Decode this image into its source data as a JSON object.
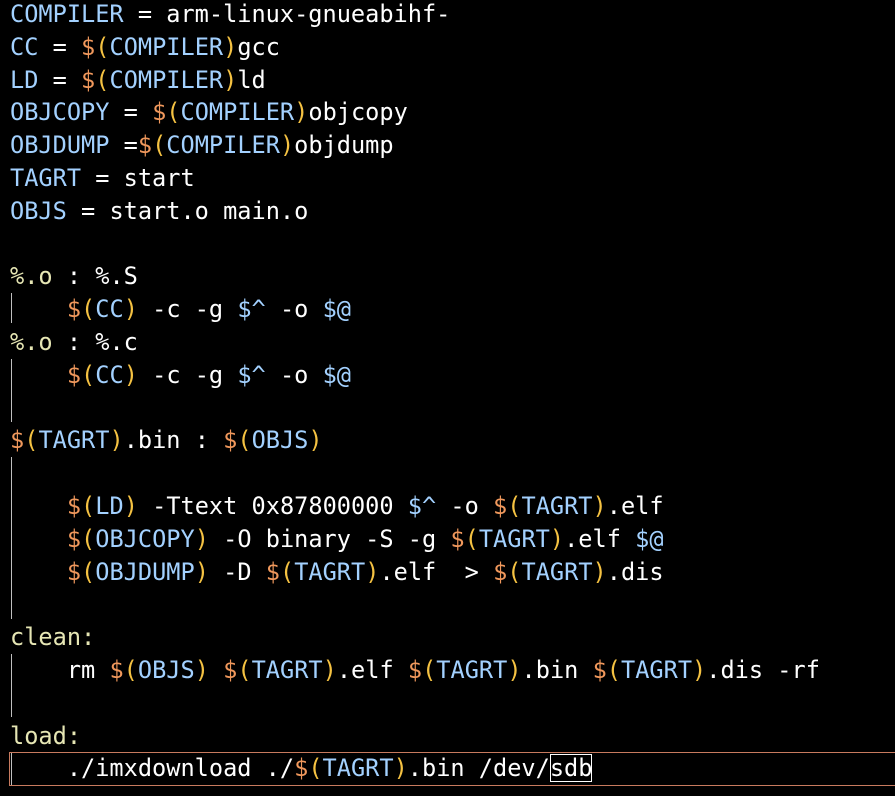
{
  "colors": {
    "background": "#000000",
    "text": "#ffffff",
    "variable": "#a3d1ff",
    "dollar": "#f0985c",
    "paren": "#f5c242",
    "target": "#e6e6b4",
    "guide": "#bfbfbf",
    "cursorline": "#c87a5e"
  },
  "lines": [
    {
      "tokens": [
        {
          "t": "COMPILER",
          "c": "variable"
        },
        {
          "t": " = arm-linux-gnueabihf-",
          "c": "text"
        }
      ]
    },
    {
      "tokens": [
        {
          "t": "CC",
          "c": "variable"
        },
        {
          "t": " = ",
          "c": "text"
        },
        {
          "t": "$",
          "c": "dollar"
        },
        {
          "t": "(",
          "c": "paren"
        },
        {
          "t": "COMPILER",
          "c": "variable"
        },
        {
          "t": ")",
          "c": "paren"
        },
        {
          "t": "gcc",
          "c": "text"
        }
      ]
    },
    {
      "tokens": [
        {
          "t": "LD",
          "c": "variable"
        },
        {
          "t": " = ",
          "c": "text"
        },
        {
          "t": "$",
          "c": "dollar"
        },
        {
          "t": "(",
          "c": "paren"
        },
        {
          "t": "COMPILER",
          "c": "variable"
        },
        {
          "t": ")",
          "c": "paren"
        },
        {
          "t": "ld",
          "c": "text"
        }
      ]
    },
    {
      "tokens": [
        {
          "t": "OBJCOPY",
          "c": "variable"
        },
        {
          "t": " = ",
          "c": "text"
        },
        {
          "t": "$",
          "c": "dollar"
        },
        {
          "t": "(",
          "c": "paren"
        },
        {
          "t": "COMPILER",
          "c": "variable"
        },
        {
          "t": ")",
          "c": "paren"
        },
        {
          "t": "objcopy",
          "c": "text"
        }
      ]
    },
    {
      "tokens": [
        {
          "t": "OBJDUMP",
          "c": "variable"
        },
        {
          "t": " =",
          "c": "text"
        },
        {
          "t": "$",
          "c": "dollar"
        },
        {
          "t": "(",
          "c": "paren"
        },
        {
          "t": "COMPILER",
          "c": "variable"
        },
        {
          "t": ")",
          "c": "paren"
        },
        {
          "t": "objdump",
          "c": "text"
        }
      ]
    },
    {
      "tokens": [
        {
          "t": "TAGRT",
          "c": "variable"
        },
        {
          "t": " = start",
          "c": "text"
        }
      ]
    },
    {
      "tokens": [
        {
          "t": "OBJS",
          "c": "variable"
        },
        {
          "t": " = start.o main.o",
          "c": "text"
        }
      ]
    },
    {
      "tokens": []
    },
    {
      "tokens": [
        {
          "t": "%.o",
          "c": "target"
        },
        {
          "t": " : %.S",
          "c": "text"
        }
      ]
    },
    {
      "tokens": [
        {
          "t": "    ",
          "c": "text"
        },
        {
          "t": "$",
          "c": "dollar"
        },
        {
          "t": "(",
          "c": "paren"
        },
        {
          "t": "CC",
          "c": "variable"
        },
        {
          "t": ")",
          "c": "paren"
        },
        {
          "t": " -c -g ",
          "c": "text"
        },
        {
          "t": "$^",
          "c": "variable"
        },
        {
          "t": " -o ",
          "c": "text"
        },
        {
          "t": "$@",
          "c": "variable"
        }
      ]
    },
    {
      "tokens": [
        {
          "t": "%.o",
          "c": "target"
        },
        {
          "t": " : %.c",
          "c": "text"
        }
      ]
    },
    {
      "tokens": [
        {
          "t": "    ",
          "c": "text"
        },
        {
          "t": "$",
          "c": "dollar"
        },
        {
          "t": "(",
          "c": "paren"
        },
        {
          "t": "CC",
          "c": "variable"
        },
        {
          "t": ")",
          "c": "paren"
        },
        {
          "t": " -c -g ",
          "c": "text"
        },
        {
          "t": "$^",
          "c": "variable"
        },
        {
          "t": " -o ",
          "c": "text"
        },
        {
          "t": "$@",
          "c": "variable"
        }
      ]
    },
    {
      "tokens": []
    },
    {
      "tokens": [
        {
          "t": "$",
          "c": "dollar"
        },
        {
          "t": "(",
          "c": "paren"
        },
        {
          "t": "TAGRT",
          "c": "variable"
        },
        {
          "t": ")",
          "c": "paren"
        },
        {
          "t": ".bin : ",
          "c": "text"
        },
        {
          "t": "$",
          "c": "dollar"
        },
        {
          "t": "(",
          "c": "paren"
        },
        {
          "t": "OBJS",
          "c": "variable"
        },
        {
          "t": ")",
          "c": "paren"
        }
      ]
    },
    {
      "tokens": []
    },
    {
      "tokens": [
        {
          "t": "    ",
          "c": "text"
        },
        {
          "t": "$",
          "c": "dollar"
        },
        {
          "t": "(",
          "c": "paren"
        },
        {
          "t": "LD",
          "c": "variable"
        },
        {
          "t": ")",
          "c": "paren"
        },
        {
          "t": " -Ttext 0x87800000 ",
          "c": "text"
        },
        {
          "t": "$^",
          "c": "variable"
        },
        {
          "t": " -o ",
          "c": "text"
        },
        {
          "t": "$",
          "c": "dollar"
        },
        {
          "t": "(",
          "c": "paren"
        },
        {
          "t": "TAGRT",
          "c": "variable"
        },
        {
          "t": ")",
          "c": "paren"
        },
        {
          "t": ".elf",
          "c": "text"
        }
      ]
    },
    {
      "tokens": [
        {
          "t": "    ",
          "c": "text"
        },
        {
          "t": "$",
          "c": "dollar"
        },
        {
          "t": "(",
          "c": "paren"
        },
        {
          "t": "OBJCOPY",
          "c": "variable"
        },
        {
          "t": ")",
          "c": "paren"
        },
        {
          "t": " -O binary -S -g ",
          "c": "text"
        },
        {
          "t": "$",
          "c": "dollar"
        },
        {
          "t": "(",
          "c": "paren"
        },
        {
          "t": "TAGRT",
          "c": "variable"
        },
        {
          "t": ")",
          "c": "paren"
        },
        {
          "t": ".elf ",
          "c": "text"
        },
        {
          "t": "$@",
          "c": "variable"
        }
      ]
    },
    {
      "tokens": [
        {
          "t": "    ",
          "c": "text"
        },
        {
          "t": "$",
          "c": "dollar"
        },
        {
          "t": "(",
          "c": "paren"
        },
        {
          "t": "OBJDUMP",
          "c": "variable"
        },
        {
          "t": ")",
          "c": "paren"
        },
        {
          "t": " -D ",
          "c": "text"
        },
        {
          "t": "$",
          "c": "dollar"
        },
        {
          "t": "(",
          "c": "paren"
        },
        {
          "t": "TAGRT",
          "c": "variable"
        },
        {
          "t": ")",
          "c": "paren"
        },
        {
          "t": ".elf  > ",
          "c": "text"
        },
        {
          "t": "$",
          "c": "dollar"
        },
        {
          "t": "(",
          "c": "paren"
        },
        {
          "t": "TAGRT",
          "c": "variable"
        },
        {
          "t": ")",
          "c": "paren"
        },
        {
          "t": ".dis",
          "c": "text"
        }
      ]
    },
    {
      "tokens": []
    },
    {
      "tokens": [
        {
          "t": "clean:",
          "c": "target"
        }
      ]
    },
    {
      "tokens": [
        {
          "t": "    rm ",
          "c": "text"
        },
        {
          "t": "$",
          "c": "dollar"
        },
        {
          "t": "(",
          "c": "paren"
        },
        {
          "t": "OBJS",
          "c": "variable"
        },
        {
          "t": ")",
          "c": "paren"
        },
        {
          "t": " ",
          "c": "text"
        },
        {
          "t": "$",
          "c": "dollar"
        },
        {
          "t": "(",
          "c": "paren"
        },
        {
          "t": "TAGRT",
          "c": "variable"
        },
        {
          "t": ")",
          "c": "paren"
        },
        {
          "t": ".elf ",
          "c": "text"
        },
        {
          "t": "$",
          "c": "dollar"
        },
        {
          "t": "(",
          "c": "paren"
        },
        {
          "t": "TAGRT",
          "c": "variable"
        },
        {
          "t": ")",
          "c": "paren"
        },
        {
          "t": ".bin ",
          "c": "text"
        },
        {
          "t": "$",
          "c": "dollar"
        },
        {
          "t": "(",
          "c": "paren"
        },
        {
          "t": "TAGRT",
          "c": "variable"
        },
        {
          "t": ")",
          "c": "paren"
        },
        {
          "t": ".dis -rf",
          "c": "text"
        }
      ]
    },
    {
      "tokens": []
    },
    {
      "tokens": [
        {
          "t": "load:",
          "c": "target"
        }
      ]
    },
    {
      "tokens": [
        {
          "t": "    ./imxdownload ./",
          "c": "text"
        },
        {
          "t": "$",
          "c": "dollar"
        },
        {
          "t": "(",
          "c": "paren"
        },
        {
          "t": "TAGRT",
          "c": "variable"
        },
        {
          "t": ")",
          "c": "paren"
        },
        {
          "t": ".bin /dev/",
          "c": "text"
        },
        {
          "t": "sdb",
          "c": "text",
          "cursor": true
        }
      ]
    }
  ]
}
